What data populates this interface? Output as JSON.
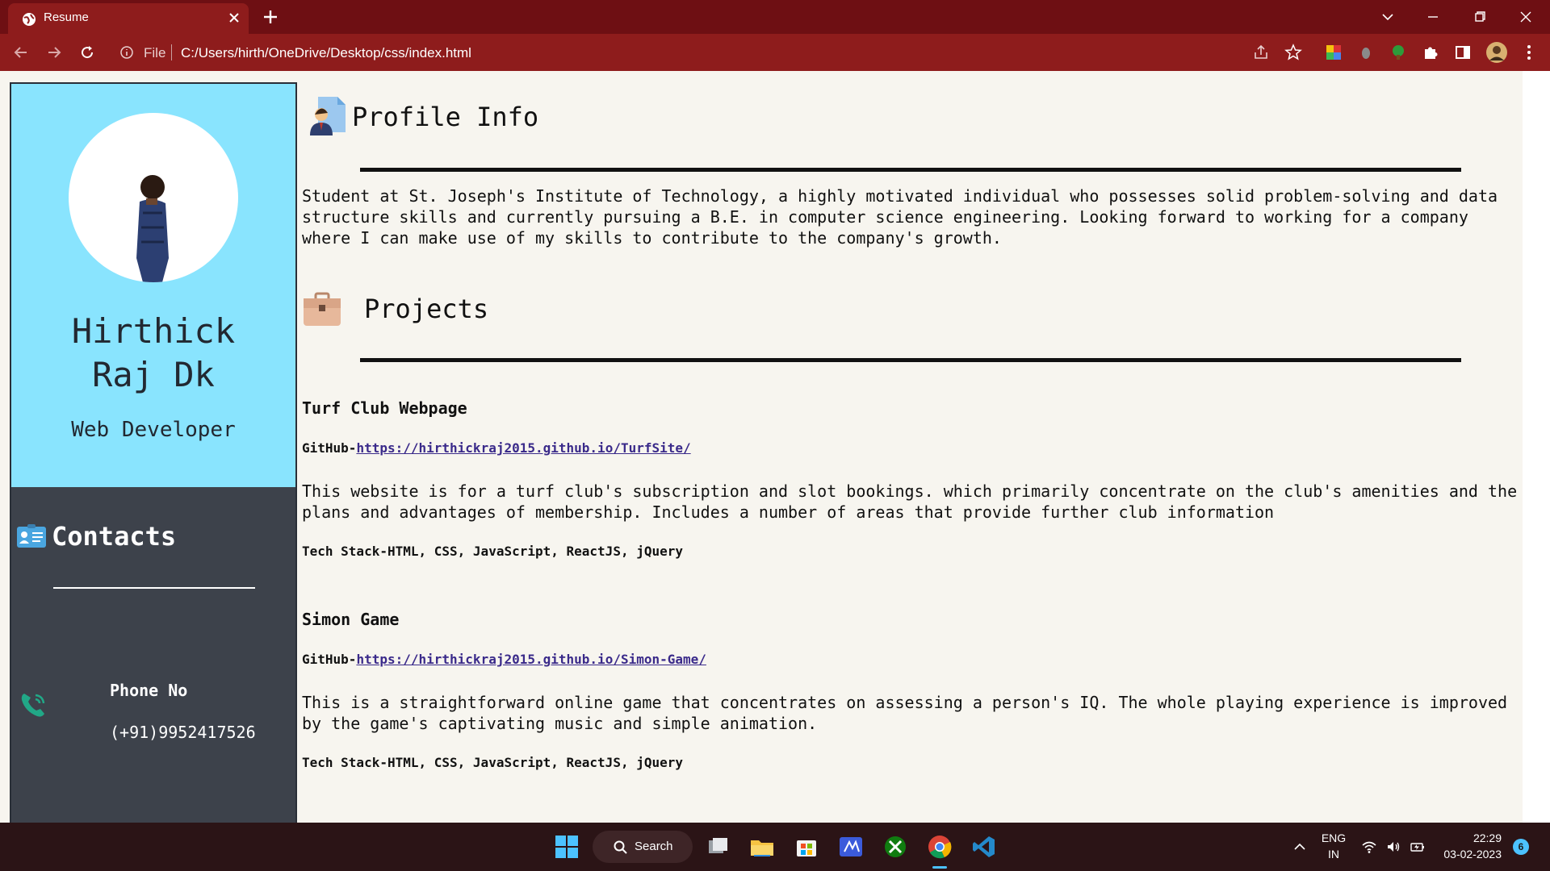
{
  "browser": {
    "tab_title": "Resume",
    "file_label": "File",
    "url": "C:/Users/hirth/OneDrive/Desktop/css/index.html"
  },
  "sidebar": {
    "name": "Hirthick\nRaj Dk",
    "role": "Web Developer",
    "contacts_title": "Contacts",
    "phone_label": "Phone No",
    "phone_value": "(+91)9952417526"
  },
  "profile": {
    "title": "Profile Info",
    "text": "Student at St. Joseph's Institute of Technology, a highly motivated individual who possesses solid problem-solving and data structure skills and currently pursuing a B.E. in computer science engineering. Looking forward to working for a company where I can make use of my skills to contribute to the company's growth."
  },
  "projects": {
    "title": "Projects",
    "items": [
      {
        "title": "Turf Club Webpage",
        "github_prefix": "GitHub-",
        "github_url": "https://hirthickraj2015.github.io/TurfSite/",
        "description": "This website is for a turf club's subscription and slot bookings. which primarily concentrate on the club's amenities and the plans and advantages of membership. Includes a number of areas that provide further club information",
        "stack": "Tech Stack-HTML, CSS, JavaScript, ReactJS, jQuery"
      },
      {
        "title": "Simon Game",
        "github_prefix": "GitHub-",
        "github_url": "https://hirthickraj2015.github.io/Simon-Game/",
        "description": "This is a straightforward online game that concentrates on assessing a person's IQ. The whole playing experience is improved by the game's captivating music and simple animation.",
        "stack": "Tech Stack-HTML, CSS, JavaScript, ReactJS, jQuery"
      }
    ]
  },
  "taskbar": {
    "search_label": "Search",
    "lang_top": "ENG",
    "lang_bottom": "IN",
    "time": "22:29",
    "date": "03-02-2023",
    "notification_count": "6"
  },
  "colors": {
    "chrome_dark": "#6e0f13",
    "chrome_tab": "#8e1c1c",
    "sidebar_top": "#89e4fe",
    "sidebar_bottom": "#3d424b",
    "page_bg": "#f7f5ef",
    "link": "#3a2a8a"
  }
}
